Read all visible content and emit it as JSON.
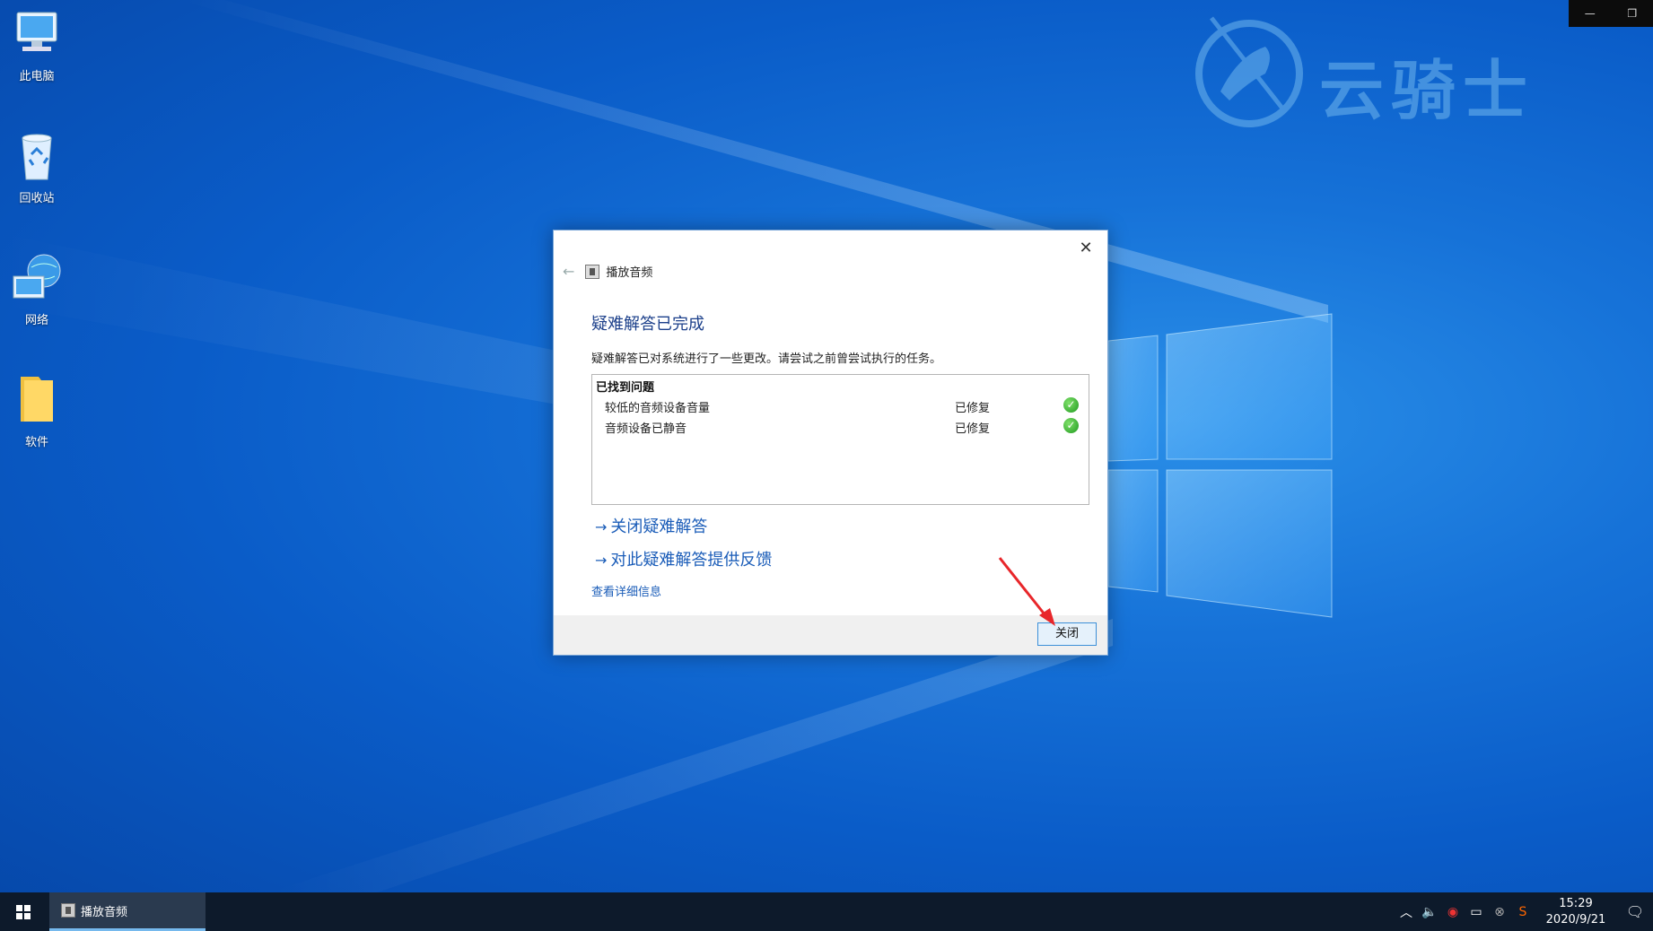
{
  "desktop": {
    "icons": [
      {
        "label": "此电脑",
        "icon": "computer-icon"
      },
      {
        "label": "回收站",
        "icon": "recycle-bin-icon"
      },
      {
        "label": "网络",
        "icon": "network-icon"
      },
      {
        "label": "软件",
        "icon": "folder-icon"
      }
    ],
    "watermark_text": "云骑士"
  },
  "dialog": {
    "app_name": "播放音频",
    "title": "疑难解答已完成",
    "description": "疑难解答已对系统进行了一些更改。请尝试之前曾尝试执行的任务。",
    "issues_header": "已找到问题",
    "issues": [
      {
        "name": "较低的音频设备音量",
        "status": "已修复"
      },
      {
        "name": "音频设备已静音",
        "status": "已修复"
      }
    ],
    "links": {
      "close_troubleshooter": "关闭疑难解答",
      "feedback": "对此疑难解答提供反馈",
      "details": "查看详细信息"
    },
    "close_button": "关闭",
    "close_glyph": "✕",
    "back_glyph": "←"
  },
  "taskbar": {
    "app_label": "播放音频",
    "time": "15:29",
    "date": "2020/9/21"
  },
  "colors": {
    "link": "#1a5cb8",
    "title": "#1b3f8a",
    "taskbar": "#0d1a2b",
    "accent": "#3c8fd8"
  }
}
